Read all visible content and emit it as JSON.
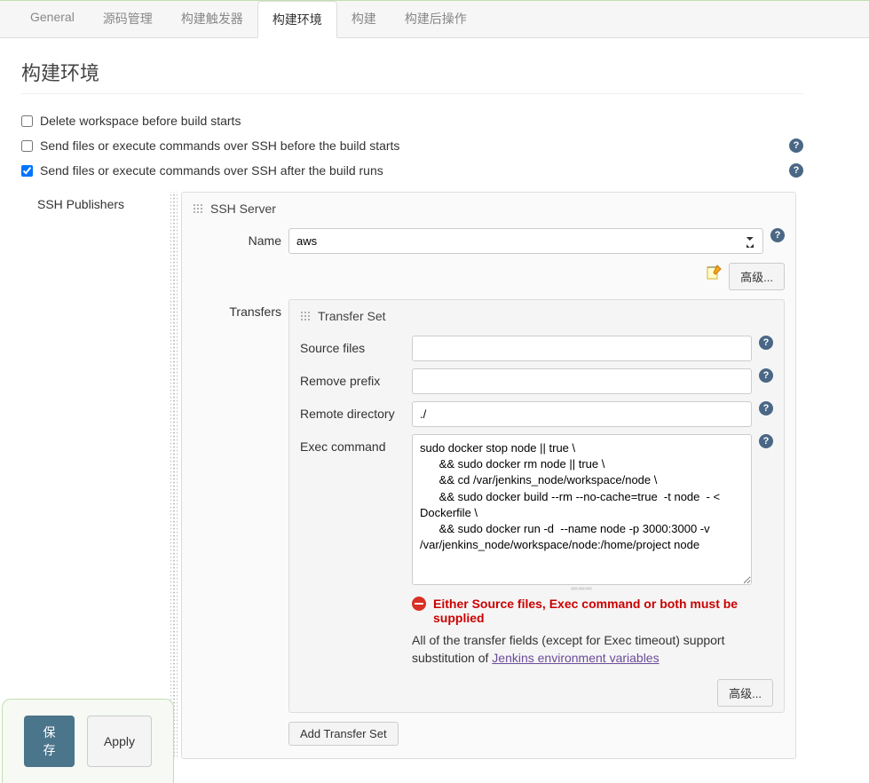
{
  "tabs": {
    "general": "General",
    "scm": "源码管理",
    "triggers": "构建触发器",
    "env": "构建环境",
    "build": "构建",
    "postbuild": "构建后操作"
  },
  "section_title": "构建环境",
  "checkboxes": {
    "delete_workspace": {
      "label": "Delete workspace before build starts",
      "checked": false
    },
    "ssh_before": {
      "label": "Send files or execute commands over SSH before the build starts",
      "checked": false
    },
    "ssh_after": {
      "label": "Send files or execute commands over SSH after the build runs",
      "checked": true
    }
  },
  "publishers_label": "SSH Publishers",
  "ssh_server": {
    "header": "SSH Server",
    "name_label": "Name",
    "name_value": "aws",
    "advanced_button": "高级..."
  },
  "transfers": {
    "label": "Transfers",
    "set_header": "Transfer Set",
    "source_files_label": "Source files",
    "source_files_value": "",
    "remove_prefix_label": "Remove prefix",
    "remove_prefix_value": "",
    "remote_directory_label": "Remote directory",
    "remote_directory_value": "./",
    "exec_command_label": "Exec command",
    "exec_command_value": "sudo docker stop node || true \\\n      && sudo docker rm node || true \\\n      && cd /var/jenkins_node/workspace/node \\\n      && sudo docker build --rm --no-cache=true  -t node  - < Dockerfile \\\n      && sudo docker run -d  --name node -p 3000:3000 -v /var/jenkins_node/workspace/node:/home/project node",
    "error_text": "Either Source files, Exec command or both must be supplied",
    "info_text_prefix": "All of the transfer fields (except for Exec timeout) support substitution of ",
    "info_link_text": "Jenkins environment variables",
    "advanced_button": "高级...",
    "add_transfer_button": "Add Transfer Set"
  },
  "buttons": {
    "save": "保存",
    "apply": "Apply"
  }
}
